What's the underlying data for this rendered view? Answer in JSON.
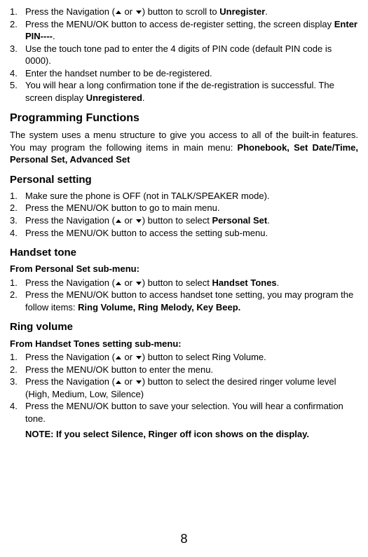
{
  "deregister": {
    "steps": [
      {
        "num": "1.",
        "pre": "Press the Navigation (",
        "mid": " or ",
        "post": ") button to scroll to ",
        "bold_end": "Unregister",
        "suffix": "."
      },
      {
        "num": "2.",
        "text": "Press the MENU/OK button to access de-register setting, the screen display ",
        "bold_end": "Enter PIN----",
        "suffix": "."
      },
      {
        "num": "3.",
        "text": "Use the touch tone pad to enter the 4 digits of PIN code (default PIN code is 0000)."
      },
      {
        "num": "4.",
        "text": "Enter the handset number to be de-registered."
      },
      {
        "num": "5.",
        "text": "You will hear a long confirmation tone if the de-registration is successful. The screen display ",
        "bold_end": "Unregistered",
        "suffix": "."
      }
    ]
  },
  "programming": {
    "heading": "Programming Functions",
    "intro_pre": "The system uses a menu structure to give you access to all of the built-in features. You may program the following items in main menu: ",
    "intro_bold": "Phonebook, Set Date/Time, Personal Set, Advanced Set"
  },
  "personal": {
    "heading": "Personal setting",
    "steps": [
      {
        "num": "1.",
        "text": "Make sure the phone is OFF (not in TALK/SPEAKER mode)."
      },
      {
        "num": "2.",
        "text": "Press the MENU/OK button to go to main menu."
      },
      {
        "num": "3.",
        "pre": "Press the Navigation (",
        "mid": " or ",
        "post": ") button to select ",
        "bold_end": "Personal Set",
        "suffix": "."
      },
      {
        "num": "4.",
        "text": "Press the MENU/OK button to access the setting sub-menu."
      }
    ]
  },
  "handset": {
    "heading": "Handset tone",
    "subheading": "From Personal Set sub-menu:",
    "steps": [
      {
        "num": "1.",
        "pre": "Press the Navigation (",
        "mid": " or ",
        "post": ") button to select ",
        "bold_end": "Handset Tones",
        "suffix": "."
      },
      {
        "num": "2.",
        "text": "Press the MENU/OK button to access handset tone setting, you may program the follow items: ",
        "bold_end": "Ring Volume, Ring Melody, Key Beep."
      }
    ]
  },
  "ring": {
    "heading": "Ring volume",
    "subheading": "From Handset Tones setting sub-menu:",
    "steps": [
      {
        "num": "1.",
        "pre": "Press the Navigation (",
        "mid": " or ",
        "post": ") button to select Ring Volume."
      },
      {
        "num": "2.",
        "text": "Press the MENU/OK button to enter the menu."
      },
      {
        "num": "3.",
        "pre": "Press the Navigation (",
        "mid": " or ",
        "post": ") button to select the desired ringer volume level (High, Medium, Low, Silence)"
      },
      {
        "num": "4.",
        "text": "Press the MENU/OK button to save your selection. You will hear a confirmation tone."
      }
    ],
    "note": "NOTE: If you select Silence, Ringer off icon shows on the display."
  },
  "page_number": "8"
}
